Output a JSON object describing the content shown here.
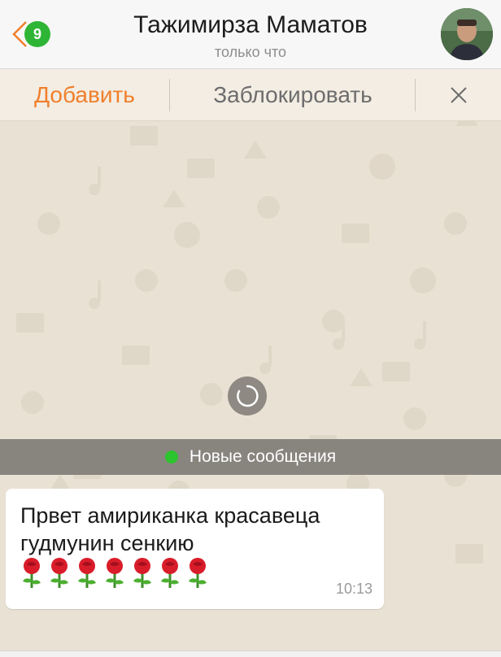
{
  "header": {
    "back_badge_count": "9",
    "title": "Тажимирза Маматов",
    "subtitle": "только что"
  },
  "actions": {
    "add_label": "Добавить",
    "block_label": "Заблокировать",
    "close_icon": "close-icon"
  },
  "chat": {
    "new_messages_label": "Новые сообщения",
    "messages": [
      {
        "text": "Првет амириканка красавеца гудмунин сенкию",
        "emoji": [
          "rose",
          "rose",
          "rose",
          "rose",
          "rose",
          "rose",
          "rose"
        ],
        "time": "10:13"
      }
    ]
  },
  "colors": {
    "accent": "#f07f2c",
    "badge": "#2fb535",
    "chat_background": "#e9e1d3",
    "new_messages_bar": "#88857f",
    "online_dot": "#2cc52f"
  }
}
